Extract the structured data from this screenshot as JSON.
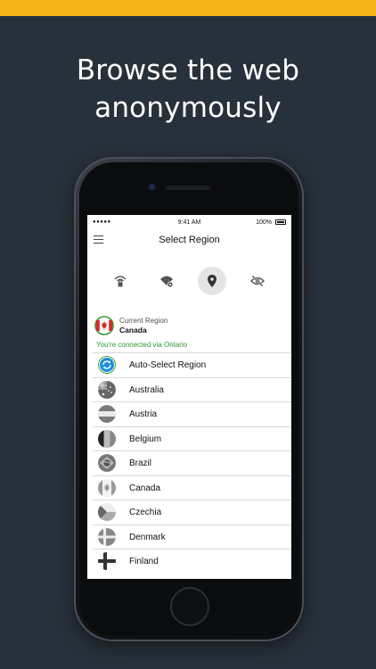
{
  "headline": {
    "line1": "Browse the web",
    "line2": "anonymously"
  },
  "status_bar": {
    "signal": "●●●●● ",
    "time": "9:41 AM",
    "battery": "100%"
  },
  "nav": {
    "title": "Select Region"
  },
  "tabs": [
    {
      "icon": "wifi-lock-icon",
      "active": false
    },
    {
      "icon": "wifi-settings-icon",
      "active": false
    },
    {
      "icon": "location-pin-icon",
      "active": true
    },
    {
      "icon": "eye-off-icon",
      "active": false
    }
  ],
  "current_region": {
    "label": "Current Region",
    "name": "Canada",
    "connection": "You're connected via Ontario"
  },
  "regions": [
    {
      "label": "Auto-Select Region",
      "icon": "auto-select-icon"
    },
    {
      "label": "Australia",
      "icon": "flag-australia-icon"
    },
    {
      "label": "Austria",
      "icon": "flag-austria-icon"
    },
    {
      "label": "Belgium",
      "icon": "flag-belgium-icon"
    },
    {
      "label": "Brazil",
      "icon": "flag-brazil-icon"
    },
    {
      "label": "Canada",
      "icon": "flag-canada-icon"
    },
    {
      "label": "Czechia",
      "icon": "flag-czechia-icon"
    },
    {
      "label": "Denmark",
      "icon": "flag-denmark-icon"
    },
    {
      "label": "Finland",
      "icon": "flag-finland-icon"
    }
  ],
  "colors": {
    "accent_bar": "#f6b418",
    "background": "#27313b",
    "connected_text": "#2e9b2e",
    "auto_select": "#1a8fd6"
  }
}
